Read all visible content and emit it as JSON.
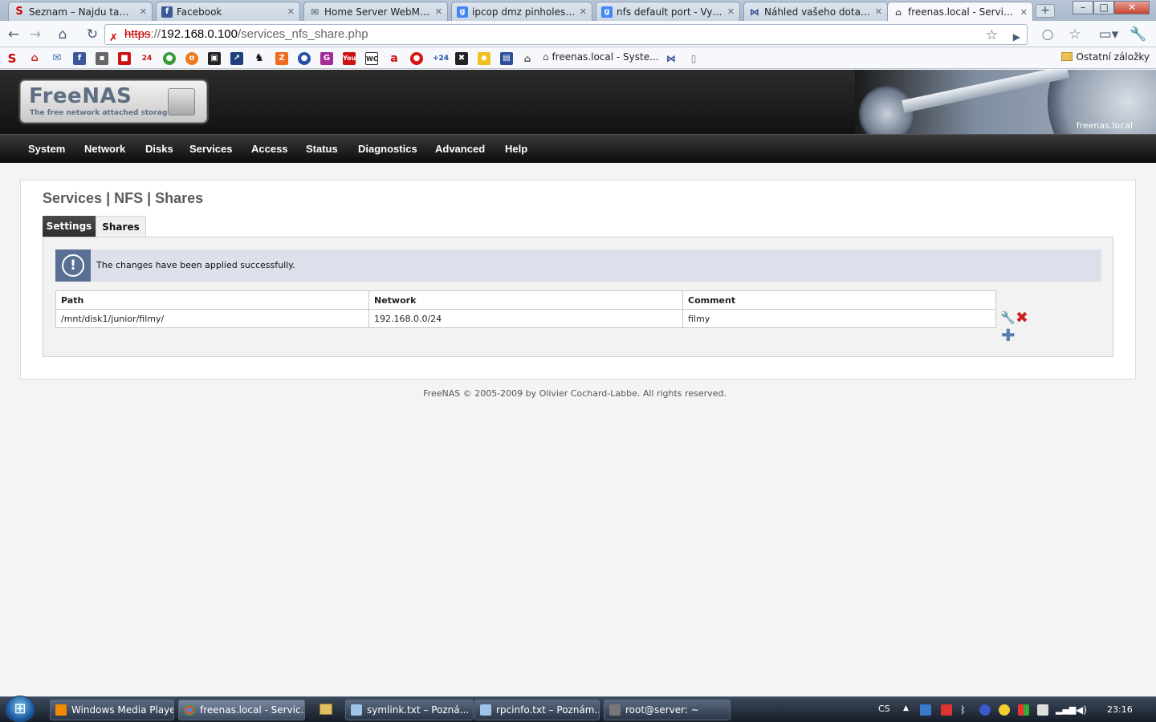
{
  "browser": {
    "tabs": [
      {
        "label": "Seznam – Najdu tam, c...",
        "active": false
      },
      {
        "label": "Facebook",
        "active": false
      },
      {
        "label": "Home Server WebMail ...",
        "active": false
      },
      {
        "label": "ipcop dmz pinholes - V...",
        "active": false
      },
      {
        "label": "nfs default port - Vyhle...",
        "active": false
      },
      {
        "label": "Náhled vašeho dotazu",
        "active": false
      },
      {
        "label": "freenas.local - Services|...",
        "active": true
      }
    ],
    "url_scheme": "https",
    "url_sep": "://",
    "url_host": "192.168.0.100",
    "url_path": "/services_nfs_share.php",
    "bookmark_freenas": "freenas.local - Syste...",
    "bookmark_other": "Ostatní záložky"
  },
  "freenas": {
    "logo": "FreeNAS",
    "logo_sub": "The free network attached storage",
    "hostname": "freenas.local",
    "menu": [
      "System",
      "Network",
      "Disks",
      "Services",
      "Access",
      "Status",
      "Diagnostics",
      "Advanced",
      "Help"
    ],
    "title": "Services | NFS | Shares",
    "tabs": {
      "settings": "Settings",
      "shares": "Shares"
    },
    "info_message": "The changes have been applied successfully.",
    "table": {
      "headers": [
        "Path",
        "Network",
        "Comment"
      ],
      "rows": [
        [
          "/mnt/disk1/junior/filmy/",
          "192.168.0.0/24",
          "filmy"
        ]
      ]
    },
    "footer": "FreeNAS © 2005-2009 by Olivier Cochard-Labbe. All rights reserved."
  },
  "taskbar": {
    "tasks": [
      {
        "label": "Windows Media Player",
        "active": false
      },
      {
        "label": "freenas.local - Servic...",
        "active": true
      },
      {
        "label": "symlink.txt – Pozná...",
        "active": false
      },
      {
        "label": "rpcinfo.txt – Poznám...",
        "active": false
      },
      {
        "label": "root@server: ~",
        "active": false
      }
    ],
    "language": "CS",
    "clock": "23:16"
  },
  "icons": {
    "back": "back-arrow-icon",
    "forward": "forward-arrow-icon",
    "home": "home-icon",
    "reload": "reload-icon",
    "bookmark_star": "star-icon",
    "wrench": "wrench-icon",
    "info": "exclamation-icon",
    "edit": "wrench-icon",
    "delete": "red-x-icon",
    "add": "blue-plus-icon"
  },
  "colors": {
    "menubar": "#1a1a1a",
    "info_bg": "#dde0ea",
    "info_icon_bg": "#5a6f94",
    "delete": "#d21d1d",
    "add": "#5b7bb1"
  }
}
